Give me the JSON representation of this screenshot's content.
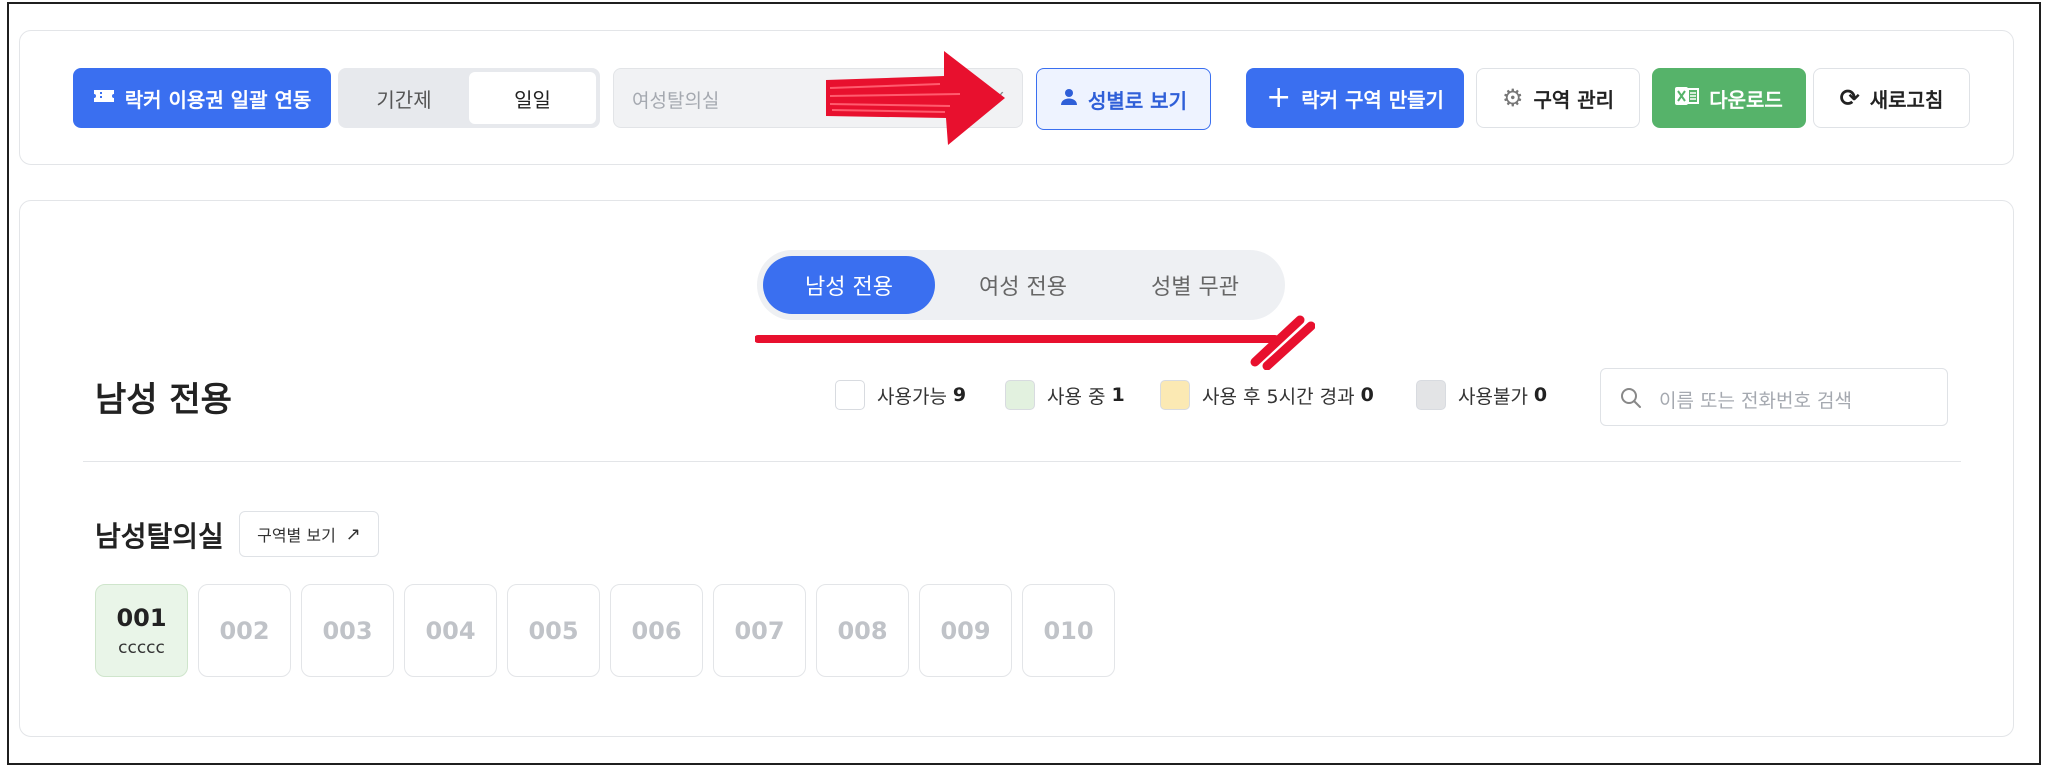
{
  "toolbar": {
    "bulk_link_label": "락커 이용권 일괄 연동",
    "period_tab": "기간제",
    "daily_tab": "일일",
    "room_select_value": "여성탈의실",
    "by_gender_label": "성별로 보기",
    "create_zone_label": "락커 구역 만들기",
    "manage_zone_label": "구역 관리",
    "download_label": "다운로드",
    "refresh_label": "새로고침"
  },
  "gender_tabs": [
    "남성 전용",
    "여성 전용",
    "성별 무관"
  ],
  "section": {
    "title": "남성 전용"
  },
  "legend": [
    {
      "label": "사용가능",
      "count": "9",
      "color": "#ffffff"
    },
    {
      "label": "사용 중",
      "count": "1",
      "color": "#e2f1df"
    },
    {
      "label": "사용 후 5시간 경과",
      "count": "0",
      "color": "#fbe9b3"
    },
    {
      "label": "사용불가",
      "count": "0",
      "color": "#e3e4e6"
    }
  ],
  "search": {
    "placeholder": "이름 또는 전화번호 검색"
  },
  "zone": {
    "title": "남성탈의실",
    "view_by_zone_label": "구역별 보기"
  },
  "lockers": [
    {
      "number": "001",
      "user": "ccccc",
      "status": "in-use"
    },
    {
      "number": "002",
      "user": "",
      "status": "available"
    },
    {
      "number": "003",
      "user": "",
      "status": "available"
    },
    {
      "number": "004",
      "user": "",
      "status": "available"
    },
    {
      "number": "005",
      "user": "",
      "status": "available"
    },
    {
      "number": "006",
      "user": "",
      "status": "available"
    },
    {
      "number": "007",
      "user": "",
      "status": "available"
    },
    {
      "number": "008",
      "user": "",
      "status": "available"
    },
    {
      "number": "009",
      "user": "",
      "status": "available"
    },
    {
      "number": "010",
      "user": "",
      "status": "available"
    }
  ],
  "colors": {
    "primary": "#3a6ff0",
    "green": "#56b36a",
    "annotation": "#e8102e"
  }
}
